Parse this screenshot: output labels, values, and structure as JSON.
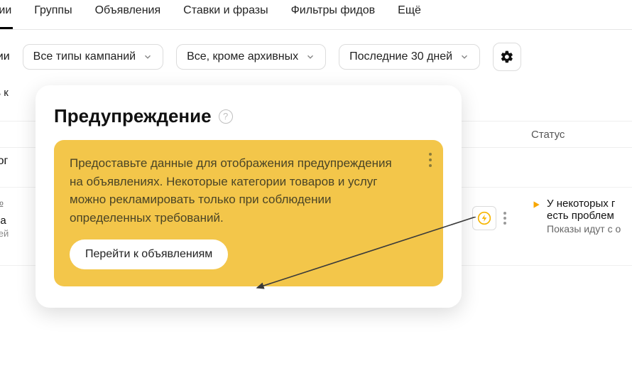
{
  "tabs": {
    "campaigns": "пании",
    "groups": "Группы",
    "ads": "Объявления",
    "bids": "Ставки и фразы",
    "feeds": "Фильтры фидов",
    "more": "Ещё"
  },
  "filters": {
    "versions": "ерсии",
    "all_types": "Все типы кампаний",
    "except_archived": "Все, кроме архивных",
    "last_30": "Последние 30 дней"
  },
  "second_row": {
    "add_campaign": "вить к"
  },
  "grid": {
    "num_header": "№",
    "total_label": "Итог",
    "status_header": "Статус",
    "row_num_icon_label": "№",
    "campaign": {
      "title": "Испа",
      "sub": "Перей"
    },
    "status": {
      "line1": "У некоторых г",
      "line2": "есть проблем",
      "sub": "Показы идут с о"
    }
  },
  "popover": {
    "title": "Предупреждение",
    "body": "Предоставьте данные для отображения предупреждения на объявлениях. Некоторые категории товаров и услуг можно рекламировать только при соблюдении определенных требований.",
    "button": "Перейти к объявлениям"
  }
}
